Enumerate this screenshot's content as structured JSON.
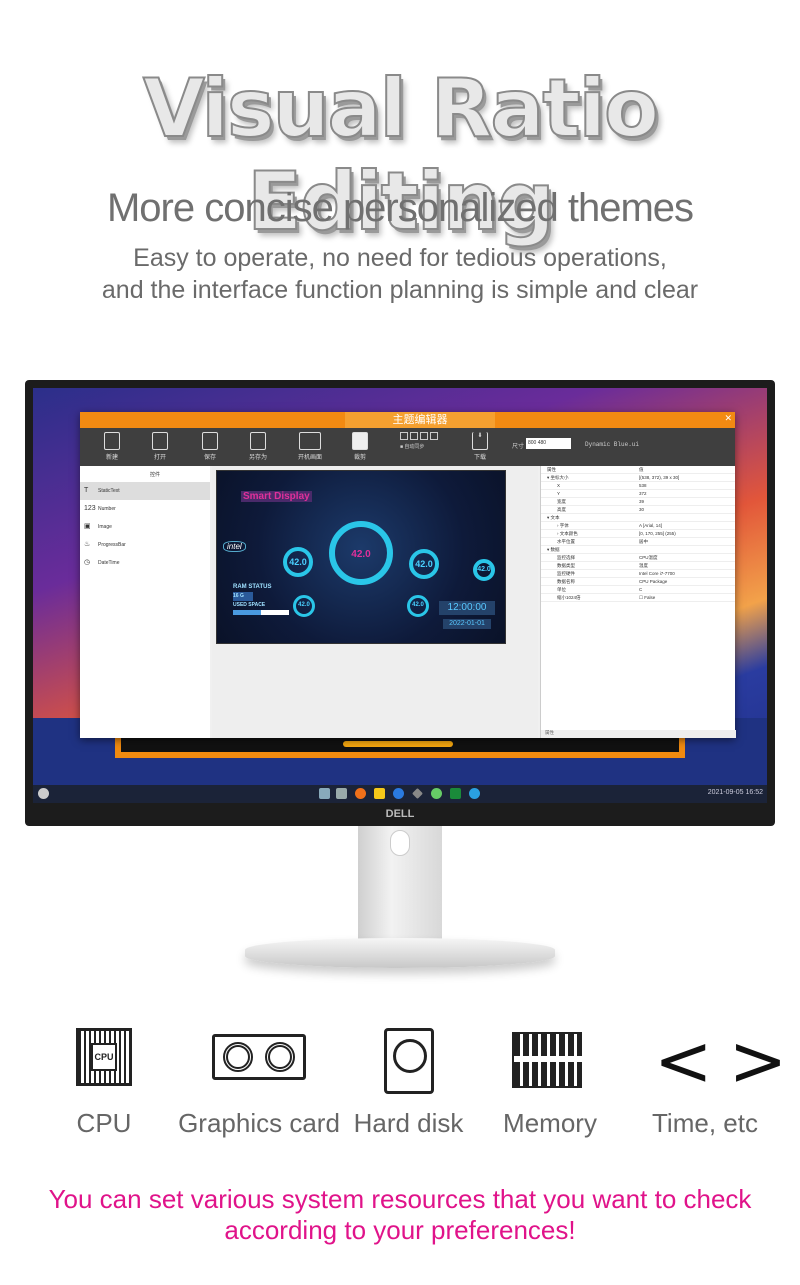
{
  "headline": "Visual Ratio Editing",
  "subtitle": "More concise personalized themes",
  "description": [
    "Easy to operate, no need for tedious operations,",
    "and the interface function planning is simple and clear"
  ],
  "monitor": {
    "brand": "DELL",
    "taskbar_clock": "2021-09-05 16:52",
    "editor": {
      "title": "主题编辑器",
      "toolbar": [
        "新建",
        "打开",
        "保存",
        "另存为",
        "开机画面",
        "裁剪",
        "下载"
      ],
      "auto_sync_label": "自动同步",
      "size_label": "尺寸",
      "size_value": "800 480",
      "file_name": "Dynamic Blue.ui",
      "components_header": "控件",
      "components": [
        {
          "icon": "T",
          "label": "StaticText"
        },
        {
          "icon": "123",
          "label": "Number"
        },
        {
          "icon": "▣",
          "label": "Image"
        },
        {
          "icon": "♨",
          "label": "ProgressBar"
        },
        {
          "icon": "◷",
          "label": "DateTime"
        }
      ],
      "preview": {
        "title": "Smart Display",
        "gauge_values": [
          "42.0",
          "42.0",
          "42.0",
          "42.0",
          "42.0",
          "42.0"
        ],
        "ram_status": "RAM STATUS",
        "ram_size": "16 G",
        "used_space": "USED SPACE",
        "used_fraction": 0.5,
        "time": "12:00:00",
        "date": "2022-01-01"
      },
      "properties_header": [
        "属性",
        "值"
      ],
      "properties": [
        [
          "▾ 坐标大小",
          "[(538, 372), 39 x 30]"
        ],
        [
          "X",
          "538"
        ],
        [
          "Y",
          "372"
        ],
        [
          "宽度",
          "39"
        ],
        [
          "高度",
          "30"
        ],
        [
          "▾ 文本",
          ""
        ],
        [
          "› 字体",
          "A [Arial, 14]"
        ],
        [
          "› 文本颜色",
          "[0, 170, 255] (255)"
        ],
        [
          "水平位置",
          "居中"
        ],
        [
          "▾ 数据",
          ""
        ],
        [
          "监控选择",
          "CPU温度"
        ],
        [
          "数据类型",
          "温度"
        ],
        [
          "监控硬件",
          "Intel Core i7-7700"
        ],
        [
          "数据名称",
          "CPU Package"
        ],
        [
          "单位",
          "C"
        ],
        [
          "缩小1024倍",
          "☐ False"
        ]
      ],
      "properties_tab": "属性",
      "text_color": "#00aaff"
    }
  },
  "features": [
    {
      "icon": "cpu-icon",
      "label": "CPU"
    },
    {
      "icon": "graphics-card-icon",
      "label": "Graphics card"
    },
    {
      "icon": "hard-disk-icon",
      "label": "Hard disk"
    },
    {
      "icon": "memory-icon",
      "label": "Memory"
    },
    {
      "icon": "code-brackets-icon",
      "label": "Time, etc"
    }
  ],
  "footer": [
    "You can set various system resources that you want to check",
    "according to your preferences!"
  ],
  "colors": {
    "accent_orange": "#f28a12",
    "footer_pink": "#e0138a"
  }
}
